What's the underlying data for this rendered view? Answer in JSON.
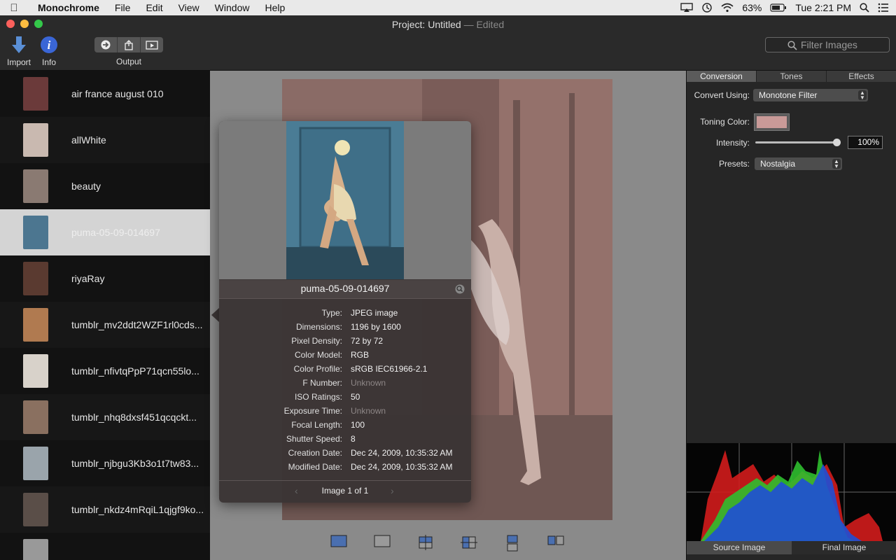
{
  "menubar": {
    "app": "Monochrome",
    "items": [
      "File",
      "Edit",
      "View",
      "Window",
      "Help"
    ],
    "battery": "63%",
    "clock": "Tue 2:21 PM"
  },
  "window": {
    "title_label": "Project:",
    "title_name": "Untitled",
    "title_status": "— Edited"
  },
  "toolbar": {
    "import_label": "Import",
    "info_label": "Info",
    "output_label": "Output",
    "filter_placeholder": "Filter Images"
  },
  "sidebar": {
    "items": [
      {
        "name": "air france august 010",
        "thumb": "#6b3a3a"
      },
      {
        "name": "allWhite",
        "thumb": "#c9b9b0"
      },
      {
        "name": "beauty",
        "thumb": "#8a7a72"
      },
      {
        "name": "puma-05-09-014697",
        "thumb": "#4c7690"
      },
      {
        "name": "riyaRay",
        "thumb": "#5a3a30"
      },
      {
        "name": "tumblr_mv2ddt2WZF1rl0cds...",
        "thumb": "#b07a50"
      },
      {
        "name": "tumblr_nfivtqPpP71qcn55lo...",
        "thumb": "#d8d2ca"
      },
      {
        "name": "tumblr_nhq8dxsf451qcqckt...",
        "thumb": "#8a7060"
      },
      {
        "name": "tumblr_njbgu3Kb3o1t7tw83...",
        "thumb": "#9aa4ab"
      },
      {
        "name": "tumblr_nkdz4mRqiL1qjgf9ko...",
        "thumb": "#5a4e48"
      },
      {
        "name": "",
        "thumb": "#999"
      }
    ],
    "selected_index": 3
  },
  "popover": {
    "title": "puma-05-09-014697",
    "info": [
      {
        "key": "Type:",
        "value": "JPEG image",
        "muted": false
      },
      {
        "key": "Dimensions:",
        "value": "1196 by 1600",
        "muted": false
      },
      {
        "key": "Pixel Density:",
        "value": "72 by 72",
        "muted": false
      },
      {
        "key": "Color Model:",
        "value": "RGB",
        "muted": false
      },
      {
        "key": "Color Profile:",
        "value": "sRGB IEC61966-2.1",
        "muted": false
      },
      {
        "key": "F Number:",
        "value": "Unknown",
        "muted": true
      },
      {
        "key": "ISO Ratings:",
        "value": "50",
        "muted": false
      },
      {
        "key": "Exposure Time:",
        "value": "Unknown",
        "muted": true
      },
      {
        "key": "Focal Length:",
        "value": "100",
        "muted": false
      },
      {
        "key": "Shutter Speed:",
        "value": "8",
        "muted": false
      },
      {
        "key": "Creation Date:",
        "value": "Dec 24, 2009, 10:35:32 AM",
        "muted": false
      },
      {
        "key": "Modified Date:",
        "value": "Dec 24, 2009, 10:35:32 AM",
        "muted": false
      }
    ],
    "footer": "Image 1 of 1"
  },
  "panel": {
    "tabs": [
      "Conversion",
      "Tones",
      "Effects"
    ],
    "active_tab": 0,
    "convert_label": "Convert Using:",
    "convert_value": "Monotone Filter",
    "toning_label": "Toning Color:",
    "toning_color": "#c99a98",
    "intensity_label": "Intensity:",
    "intensity_value": "100%",
    "intensity_fraction": 1.0,
    "presets_label": "Presets:",
    "presets_value": "Nostalgia",
    "histogram_tabs": [
      "Source Image",
      "Final Image"
    ],
    "histogram_active": 1
  }
}
